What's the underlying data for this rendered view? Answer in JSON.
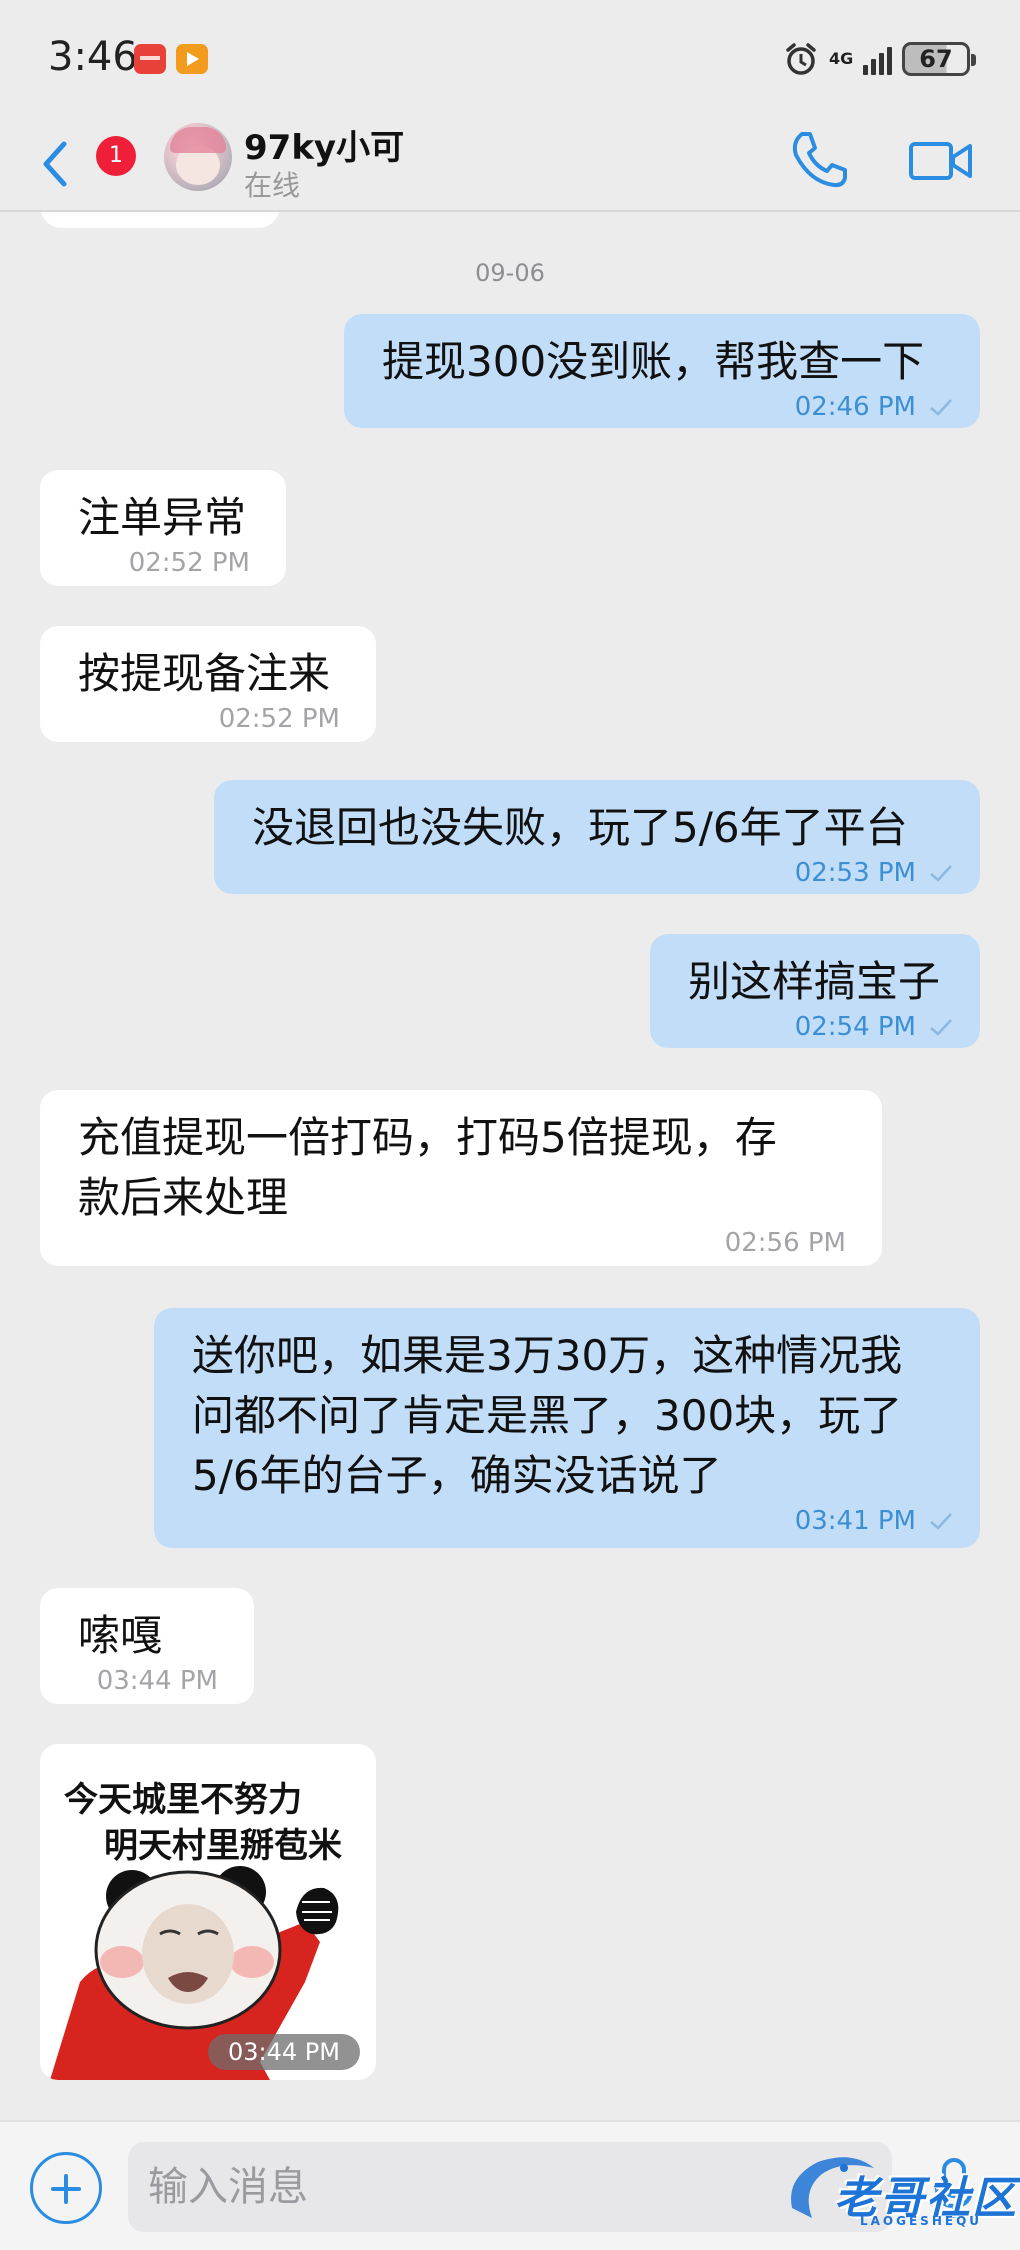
{
  "status_bar": {
    "time": "3:46",
    "network": "4G",
    "battery": "67",
    "icons": [
      "huawei-mall-icon",
      "video-app-icon",
      "alarm-icon",
      "signal-icon",
      "battery-icon"
    ]
  },
  "header": {
    "unread_count": "1",
    "contact_name": "97ky小可",
    "contact_status": "在线",
    "icons": [
      "back-chevron-icon",
      "phone-call-icon",
      "video-call-icon"
    ]
  },
  "chat": {
    "date_separator": "09-06",
    "messages": [
      {
        "dir": "out",
        "text": "提现300没到账，帮我查一下",
        "time": "02:46 PM"
      },
      {
        "dir": "in",
        "text": "注单异常",
        "time": "02:52 PM"
      },
      {
        "dir": "in",
        "text": "按提现备注来",
        "time": "02:52 PM"
      },
      {
        "dir": "out",
        "text": "没退回也没失败，玩了5/6年了平台",
        "time": "02:53 PM"
      },
      {
        "dir": "out",
        "text": "别这样搞宝子",
        "time": "02:54 PM"
      },
      {
        "dir": "in",
        "text": "充值提现一倍打码，打码5倍提现，存\n款后来处理",
        "time": "02:56 PM"
      },
      {
        "dir": "out",
        "text": "送你吧，如果是3万30万，这种情况我\n问都不问了肯定是黑了，300块，玩了\n5/6年的台子，确实没话说了",
        "time": "03:41 PM"
      },
      {
        "dir": "in",
        "text": "嗦嘎",
        "time": "03:44 PM"
      }
    ],
    "sticker": {
      "line1": "今天城里不努力",
      "line2": "明天村里掰苞米",
      "time": "03:44 PM"
    }
  },
  "input": {
    "placeholder": "输入消息",
    "watermark": "老哥社区",
    "watermark_sub": "LAOGESHEQU"
  },
  "colors": {
    "outgoing_bubble": "#c2ddf8",
    "incoming_bubble": "#ffffff",
    "accent": "#2b8de1",
    "background": "#ececed"
  }
}
